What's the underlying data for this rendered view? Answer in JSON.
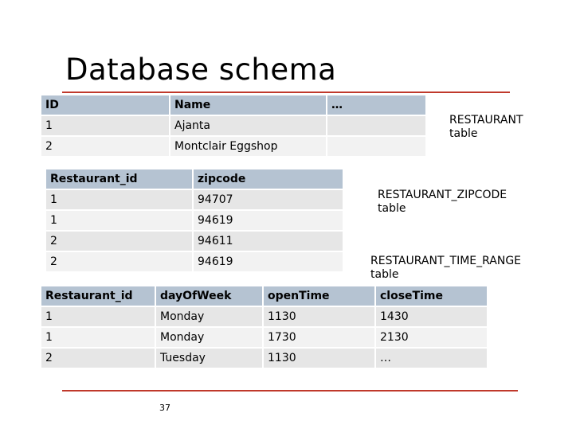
{
  "title": "Database schema",
  "page_number": "37",
  "accent_color": "#c0392b",
  "header_color": "#b5c3d2",
  "tables": [
    {
      "label": "RESTAURANT\ntable",
      "headers": [
        "ID",
        "Name",
        "…"
      ],
      "rows": [
        [
          "1",
          "Ajanta",
          ""
        ],
        [
          "2",
          "Montclair Eggshop",
          ""
        ]
      ]
    },
    {
      "label": "RESTAURANT_ZIPCODE\ntable",
      "headers": [
        "Restaurant_id",
        "zipcode"
      ],
      "rows": [
        [
          "1",
          "94707"
        ],
        [
          "1",
          "94619"
        ],
        [
          "2",
          "94611"
        ],
        [
          "2",
          "94619"
        ]
      ]
    },
    {
      "label": "RESTAURANT_TIME_RANGE\ntable",
      "headers": [
        "Restaurant_id",
        "dayOfWeek",
        "openTime",
        "closeTime"
      ],
      "rows": [
        [
          "1",
          "Monday",
          "1130",
          "1430"
        ],
        [
          "1",
          "Monday",
          "1730",
          "2130"
        ],
        [
          "2",
          "Tuesday",
          "1130",
          "…"
        ]
      ]
    }
  ]
}
